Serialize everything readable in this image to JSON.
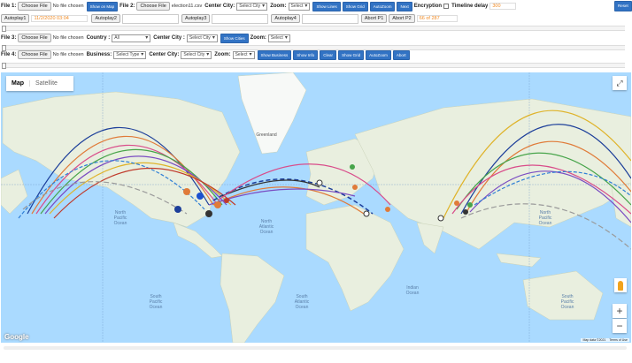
{
  "row1": {
    "file1_label": "File 1:",
    "choose_file": "Choose File",
    "no_file": "No file chosen",
    "show_on_map": "Show on Map",
    "file2_label": "File 2:",
    "file2_name": "election11.csv",
    "center_city_label": "Center City:",
    "center_city_value": "Select City",
    "zoom_label": "Zoom:",
    "zoom_value": "Select",
    "show_lines": "Show Lines",
    "show_grid": "Show Grid",
    "autozoom": "AutoZoom",
    "next": "Next",
    "encryption_label": "Encryption",
    "timeline_delay_label": "Timeline delay",
    "timeline_delay_value": "300",
    "reset": "Reset"
  },
  "row2": {
    "autoplay1": "Autoplay1",
    "date_value": "11/2/2020 03:04",
    "autoplay2": "Autoplay2",
    "autoplay3": "Autoplay3",
    "autoplay4": "Autoplay4",
    "abort_p1": "Abort P1",
    "abort_p2": "Abort P2",
    "count": "66 of 287"
  },
  "row3": {
    "file3_label": "File 3:",
    "choose_file": "Choose File",
    "no_file": "No file chosen",
    "country_label": "Country :",
    "country_value": "All",
    "center_city_label": "Center City :",
    "center_city_value": "Select City",
    "show_cities": "Show Cities",
    "zoom_label": "Zoom:",
    "zoom_value": "Select"
  },
  "row4": {
    "file4_label": "File 4:",
    "choose_file": "Choose File",
    "no_file": "No file chosen",
    "business_label": "Business:",
    "business_value": "Select Type",
    "center_city_label": "Center City:",
    "center_city_value": "Select City",
    "zoom_label": "Zoom:",
    "zoom_value": "Select",
    "show_business": "Show Business",
    "show_info": "Show Info",
    "clear": "Clear",
    "show_grid": "Show Grid",
    "autozoom": "AutoZoom",
    "abort": "Abort"
  },
  "map": {
    "tab_map": "Map",
    "tab_satellite": "Satellite",
    "google": "Google",
    "attribution": "Map data ©2021",
    "terms": "Terms of Use",
    "zoom_in": "+",
    "zoom_out": "−",
    "labels": {
      "greenland": "Greenland",
      "north_atlantic": "North\nAtlantic\nOcean",
      "north_pacific_left": "North\nPacific\nOcean",
      "north_pacific_right": "North\nPacific\nOcean",
      "south_pacific_left": "South\nPacific\nOcean",
      "south_pacific_right": "South\nPacific\nOcean",
      "south_atlantic": "South\nAtlantic\nOcean",
      "indian": "Indian\nOcean"
    }
  },
  "colors": {
    "button_blue": "#3273c4",
    "ocean": "#aadaff",
    "land": "#e8eedd",
    "orange_text": "#f08a24"
  }
}
